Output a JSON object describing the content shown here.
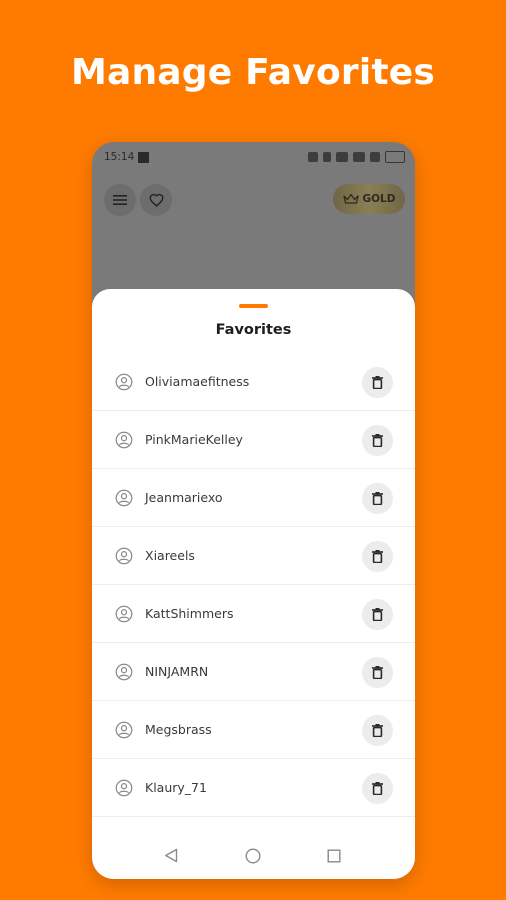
{
  "headline": "Manage Favorites",
  "status_bar": {
    "time": "15:14"
  },
  "header": {
    "menu_icon": "hamburger-menu-icon",
    "favorites_icon": "heart-icon",
    "gold_button": {
      "icon": "crown-icon",
      "label": "GOLD"
    }
  },
  "sheet": {
    "title": "Favorites",
    "favorites": [
      {
        "username": "Oliviamaefitness"
      },
      {
        "username": "PinkMarieKelley"
      },
      {
        "username": "Jeanmariexo"
      },
      {
        "username": "Xiareels"
      },
      {
        "username": "KattShimmers"
      },
      {
        "username": "NINJAMRN"
      },
      {
        "username": "Megsbrass"
      },
      {
        "username": "Klaury_71"
      }
    ],
    "row_icon": "user-circle-icon",
    "delete_icon": "trash-icon"
  },
  "nav_bar": {
    "back_icon": "back-triangle-icon",
    "home_icon": "home-circle-icon",
    "recent_icon": "recent-apps-square-icon"
  },
  "colors": {
    "background": "#FF7B00",
    "accent": "#FF7B00",
    "gold_button": "#8b7f55"
  }
}
